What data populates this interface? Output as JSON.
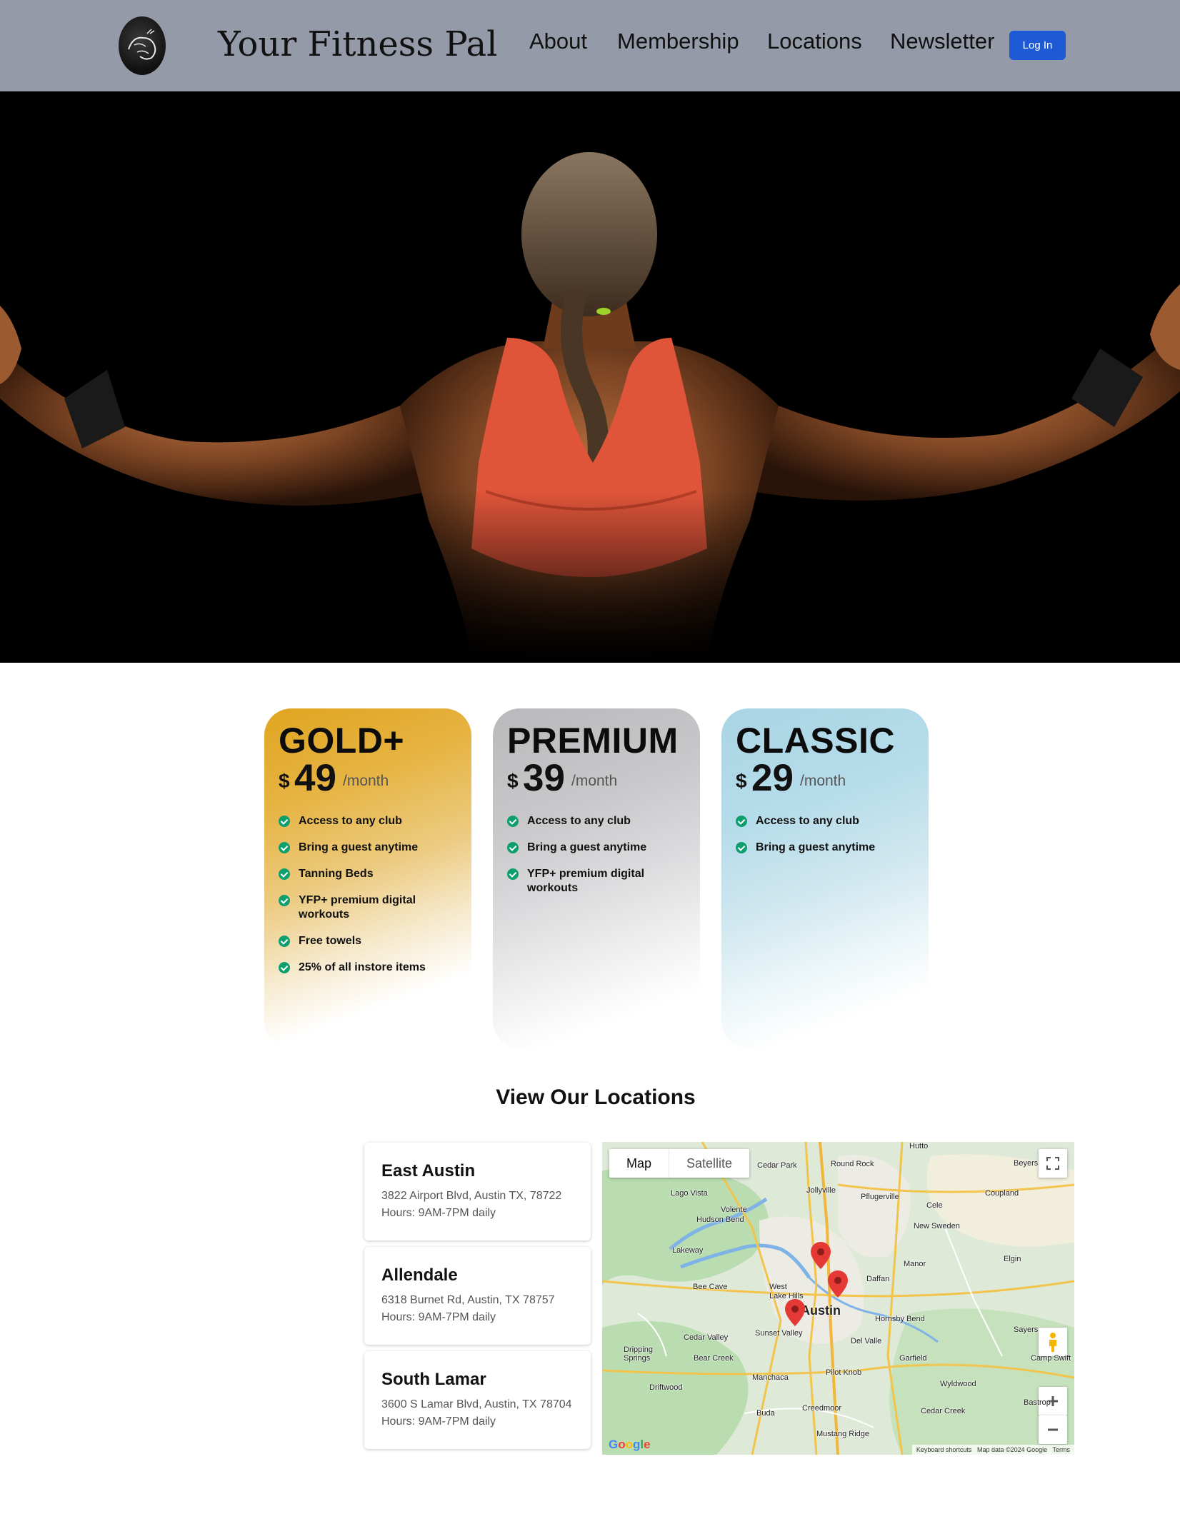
{
  "header": {
    "brand": "Your Fitness Pal",
    "nav": [
      "About",
      "Membership",
      "Locations",
      "Newsletter"
    ],
    "login_label": "Log In",
    "colors": {
      "bar": "#959aa9",
      "login": "#1f5ad6"
    }
  },
  "hero": {
    "image": "athlete-back-photo"
  },
  "plans": [
    {
      "tier": "GOLD+",
      "currency": "$",
      "price": "49",
      "period": "/month",
      "features": [
        "Access to any club",
        "Bring a guest anytime",
        "Tanning Beds",
        "YFP+ premium digital workouts",
        "Free towels",
        "25% of all instore items"
      ]
    },
    {
      "tier": "PREMIUM",
      "currency": "$",
      "price": "39",
      "period": "/month",
      "features": [
        "Access to any club",
        "Bring a guest anytime",
        "YFP+ premium digital workouts"
      ]
    },
    {
      "tier": "CLASSIC",
      "currency": "$",
      "price": "29",
      "period": "/month",
      "features": [
        "Access to any club",
        "Bring a guest anytime"
      ]
    }
  ],
  "locations": {
    "title": "View Our Locations",
    "items": [
      {
        "name": "East Austin",
        "address": "3822 Airport Blvd, Austin TX, 78722",
        "hours": "Hours: 9AM-7PM daily"
      },
      {
        "name": "Allendale",
        "address": "6318 Burnet Rd, Austin, TX 78757",
        "hours": "Hours: 9AM-7PM daily"
      },
      {
        "name": "South Lamar",
        "address": "3600 S Lamar Blvd, Austin, TX 78704",
        "hours": "Hours: 9AM-7PM daily"
      }
    ]
  },
  "map": {
    "type_buttons": [
      "Map",
      "Satellite"
    ],
    "labels": [
      "Hutto",
      "Cedar Park",
      "Round Rock",
      "Beyers",
      "Jollyville",
      "Pflugerville",
      "Coupland",
      "Lago Vista",
      "Volente",
      "Hudson Bend",
      "Cele",
      "New Sweden",
      "Lakeway",
      "Manor",
      "Elgin",
      "Bee Cave",
      "West Lake Hills",
      "Daffan",
      "Austin",
      "Hornsby Bend",
      "Sayers",
      "Cedar Valley",
      "Sunset Valley",
      "Del Valle",
      "Dripping Springs",
      "Bear Creek",
      "Garfield",
      "Camp Swift",
      "Pilot Knob",
      "Driftwood",
      "Manchaca",
      "Wyldwood",
      "Buda",
      "Creedmoor",
      "Cedar Creek",
      "Mustang Ridge",
      "Bastrop"
    ],
    "attribution": [
      "Keyboard shortcuts",
      "Map data ©2024 Google",
      "Terms"
    ],
    "logo": "Google",
    "pin_color": "#e53935"
  }
}
